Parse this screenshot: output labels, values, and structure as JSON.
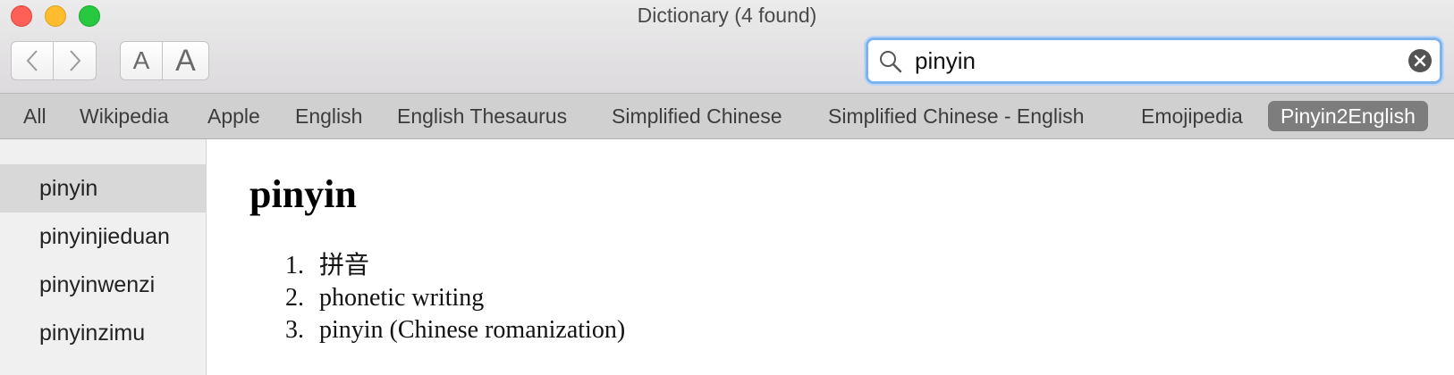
{
  "window": {
    "title": "Dictionary (4 found)"
  },
  "toolbar": {
    "font_small_label": "A",
    "font_large_label": "A"
  },
  "search": {
    "value": "pinyin",
    "placeholder": ""
  },
  "tabs": [
    {
      "label": "All"
    },
    {
      "label": "Wikipedia"
    },
    {
      "label": "Apple"
    },
    {
      "label": "English"
    },
    {
      "label": "English Thesaurus"
    },
    {
      "label": "Simplified Chinese"
    },
    {
      "label": "Simplified Chinese - English"
    },
    {
      "label": "Emojipedia"
    },
    {
      "label": "Pinyin2English",
      "active": true
    }
  ],
  "sidebar": {
    "items": [
      {
        "label": "pinyin",
        "selected": true
      },
      {
        "label": "pinyinjieduan"
      },
      {
        "label": "pinyinwenzi"
      },
      {
        "label": "pinyinzimu"
      }
    ]
  },
  "entry": {
    "headword": "pinyin",
    "definitions": [
      {
        "num": "1.",
        "text": "拼音"
      },
      {
        "num": "2.",
        "text": "phonetic writing"
      },
      {
        "num": "3.",
        "text": "pinyin (Chinese romanization)"
      }
    ]
  },
  "colors": {
    "active_tab_bg": "#7e7d7e",
    "search_focus_ring": "#80b3ee",
    "close": "#fe5f57",
    "minimize": "#febc2e",
    "zoom": "#28c840"
  },
  "icons": {
    "back": "chevron-left-icon",
    "forward": "chevron-right-icon",
    "search": "magnifier-icon",
    "clear": "clear-x-icon"
  }
}
